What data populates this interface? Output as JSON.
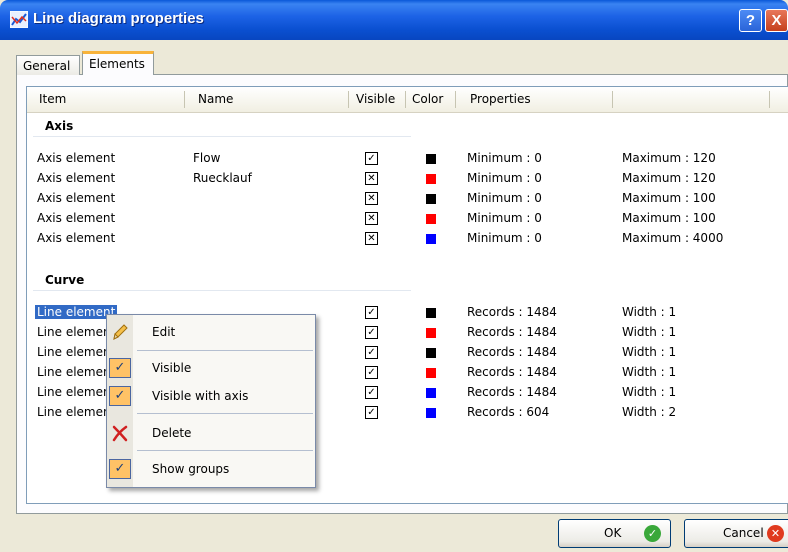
{
  "window": {
    "title": "Line diagram properties",
    "help_label": "?",
    "close_label": "X"
  },
  "tabs": [
    {
      "label": "General",
      "active": false
    },
    {
      "label": "Elements",
      "active": true
    }
  ],
  "columns": [
    "Item",
    "Name",
    "Visible",
    "Color",
    "Properties"
  ],
  "groups": {
    "axis": {
      "title": "Axis",
      "rows": [
        {
          "item": "Axis element",
          "name": "Flow",
          "visible": true,
          "color": "#000000",
          "prop1": "Minimum : 0",
          "prop2": "Maximum : 120"
        },
        {
          "item": "Axis element",
          "name": "Ruecklauf",
          "visible": false,
          "color": "#ff0000",
          "prop1": "Minimum : 0",
          "prop2": "Maximum : 120"
        },
        {
          "item": "Axis element",
          "name": "",
          "visible": false,
          "color": "#000000",
          "prop1": "Minimum : 0",
          "prop2": "Maximum : 100"
        },
        {
          "item": "Axis element",
          "name": "",
          "visible": false,
          "color": "#ff0000",
          "prop1": "Minimum : 0",
          "prop2": "Maximum : 100"
        },
        {
          "item": "Axis element",
          "name": "",
          "visible": false,
          "color": "#0000ff",
          "prop1": "Minimum : 0",
          "prop2": "Maximum : 4000"
        }
      ]
    },
    "curve": {
      "title": "Curve",
      "rows": [
        {
          "item": "Line element",
          "name": "",
          "visible": true,
          "color": "#000000",
          "prop1": "Records : 1484",
          "prop2": "Width : 1",
          "selected": true
        },
        {
          "item": "Line element",
          "name": "",
          "visible": true,
          "color": "#ff0000",
          "prop1": "Records : 1484",
          "prop2": "Width : 1"
        },
        {
          "item": "Line element",
          "name": "",
          "visible": true,
          "color": "#000000",
          "prop1": "Records : 1484",
          "prop2": "Width : 1"
        },
        {
          "item": "Line element",
          "name": "",
          "visible": true,
          "color": "#ff0000",
          "prop1": "Records : 1484",
          "prop2": "Width : 1"
        },
        {
          "item": "Line element",
          "name": "",
          "visible": true,
          "color": "#0000ff",
          "prop1": "Records : 1484",
          "prop2": "Width : 1"
        },
        {
          "item": "Line element",
          "name": "",
          "visible": true,
          "color": "#0000ff",
          "prop1": "Records : 604",
          "prop2": "Width : 2"
        }
      ]
    }
  },
  "context_menu": {
    "items": [
      {
        "label": "Edit",
        "icon": "pencil-icon"
      },
      {
        "label": "Visible",
        "checked": true
      },
      {
        "label": "Visible with axis",
        "checked": true
      },
      {
        "label": "Delete",
        "icon": "delete-x-icon"
      },
      {
        "label": "Show groups",
        "checked": true
      }
    ]
  },
  "buttons": {
    "ok_label": "OK",
    "cancel_label": "Cancel"
  }
}
